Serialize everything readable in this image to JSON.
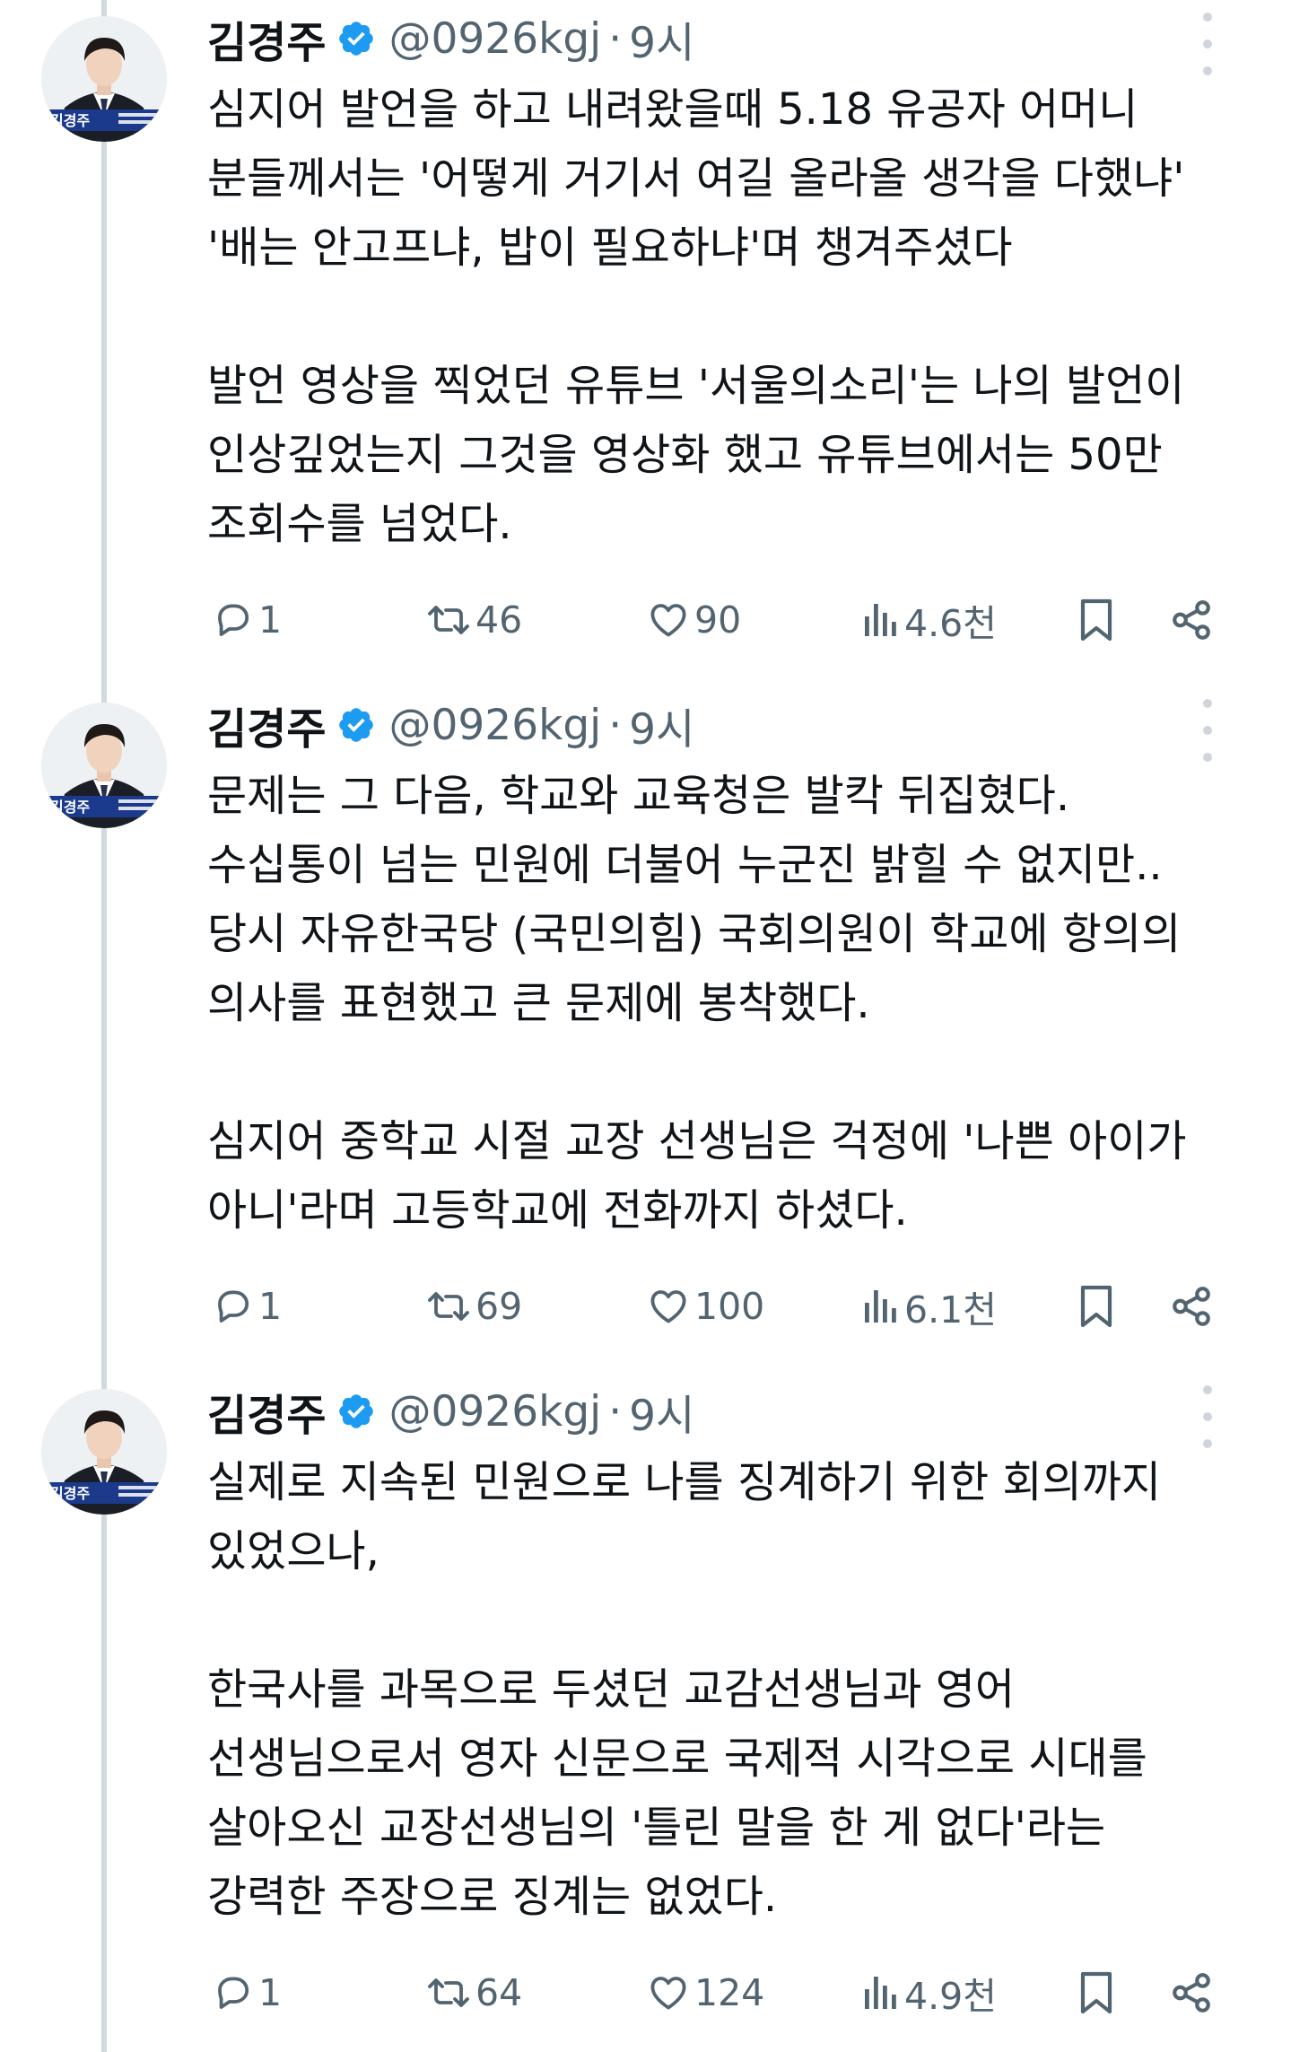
{
  "tweets": [
    {
      "author": "김경주",
      "handle": "@0926kgj",
      "separator": "·",
      "time": "9시",
      "avatar_badge": "김경주",
      "paragraphs": [
        [
          "심지어 발언을 하고 내려왔을때 5.18 유공자 어머니",
          "분들께서는 '어떻게 거기서 여길 올라올 생각을 다했냐'",
          "'배는 안고프냐, 밥이 필요하냐'며 챙겨주셨다"
        ],
        [
          "발언 영상을 찍었던 유튜브 '서울의소리'는 나의 발언이",
          "인상깊었는지 그것을 영상화 했고 유튜브에서는 50만",
          "조회수를 넘었다."
        ]
      ],
      "stats": {
        "replies": "1",
        "reposts": "46",
        "likes": "90",
        "views": "4.6천"
      }
    },
    {
      "author": "김경주",
      "handle": "@0926kgj",
      "separator": "·",
      "time": "9시",
      "avatar_badge": "김경주",
      "paragraphs": [
        [
          "문제는 그 다음, 학교와 교육청은 발칵 뒤집혔다.",
          "수십통이 넘는 민원에 더불어 누군진 밝힐 수 없지만..",
          "당시 자유한국당 (국민의힘) 국회의원이 학교에 항의의",
          "의사를 표현했고 큰 문제에 봉착했다."
        ],
        [
          "심지어 중학교 시절 교장 선생님은 걱정에 '나쁜 아이가",
          "아니'라며 고등학교에 전화까지 하셨다."
        ]
      ],
      "stats": {
        "replies": "1",
        "reposts": "69",
        "likes": "100",
        "views": "6.1천"
      }
    },
    {
      "author": "김경주",
      "handle": "@0926kgj",
      "separator": "·",
      "time": "9시",
      "avatar_badge": "김경주",
      "paragraphs": [
        [
          "실제로 지속된 민원으로 나를 징계하기 위한 회의까지",
          "있었으나,"
        ],
        [
          "한국사를 과목으로 두셨던 교감선생님과 영어",
          "선생님으로서 영자 신문으로 국제적 시각으로 시대를",
          "살아오신 교장선생님의 '틀린 말을 한 게 없다'라는",
          "강력한 주장으로 징계는 없었다."
        ]
      ],
      "stats": {
        "replies": "1",
        "reposts": "64",
        "likes": "124",
        "views": "4.9천"
      }
    }
  ],
  "colors": {
    "text": "#0f1419",
    "secondary": "#536471",
    "verified": "#1d9bf0",
    "thread_line": "#cfd9de",
    "avatar_badge_bg": "#1b3a8c"
  },
  "icons": [
    "verified-badge-icon",
    "more-icon",
    "reply-icon",
    "repost-icon",
    "like-icon",
    "views-icon",
    "bookmark-icon",
    "share-icon"
  ]
}
